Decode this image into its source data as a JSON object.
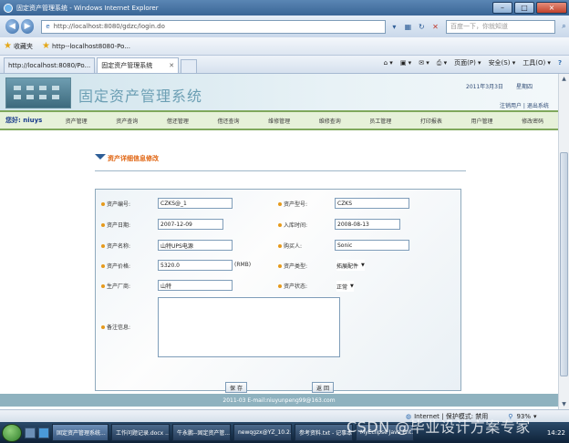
{
  "window": {
    "title": "固定资产管理系统 - Windows Internet Explorer",
    "min": "–",
    "max": "□",
    "close": "×"
  },
  "address": {
    "url": "http://localhost:8080/gdzc/login.do",
    "search_placeholder": "百度一下，你就知道"
  },
  "favorites": {
    "label": "收藏夹",
    "item": "http--localhost8080-Po..."
  },
  "tabs": [
    {
      "label": "http://localhost:8080/Po..."
    },
    {
      "label": "固定资产管理系统"
    }
  ],
  "toolbar": {
    "page": "页面(P) ▾",
    "safety": "安全(S) ▾",
    "tools": "工具(O) ▾",
    "help": "?"
  },
  "header": {
    "system_name": "固定资产管理系统",
    "date": "2011年3月3日",
    "weekday": "星期四",
    "links": "注销用户 | 退出系统"
  },
  "menu": {
    "greeting": "您好: niuys",
    "items": [
      "资产管理",
      "资产查询",
      "借还管理",
      "借还查询",
      "维修管理",
      "维修查询",
      "员工管理",
      "打印报表",
      "用户管理",
      "修改密码"
    ]
  },
  "section": {
    "title": "资产详细信息修改"
  },
  "form": {
    "asset_no_label": "资产编号:",
    "asset_no": "CZKS@_1",
    "asset_model_label": "资产型号:",
    "asset_model": "CZKS",
    "asset_date_label": "资产日期:",
    "asset_date": "2007-12-09",
    "store_date_label": "入库时间:",
    "store_date": "2008-08-13",
    "asset_name_label": "资产名称:",
    "asset_name": "山特UPS电源",
    "buyer_label": "购买人:",
    "buyer": "Sonic",
    "price_label": "资产价格:",
    "price": "5320.0",
    "price_unit": "(RMB)",
    "type_label": "资产类型:",
    "type": "拓展配件",
    "vendor_label": "生产厂商:",
    "vendor": "山特",
    "status_label": "资产状态:",
    "status": "正常",
    "remark_label": "备注信息:",
    "remark": "",
    "save_label": "保 存",
    "back_label": "返 回"
  },
  "footer": {
    "text": "2011-03 E-mail:niuyunpeng99@163.com"
  },
  "status": {
    "zone": "Internet | 保护模式: 禁用",
    "zoom": "93%"
  },
  "taskbar": {
    "tasks": [
      "固定资产管理系统...",
      "工作问题记录.docx ...",
      "牛永鹏--固定资产管...",
      "newqgzx@YZ_10.2...",
      "参考资料.txt - 记事本",
      "MyEclipse Java Ent..."
    ],
    "time": "14:22"
  },
  "watermark": "CSDN @毕业设计方案专家"
}
